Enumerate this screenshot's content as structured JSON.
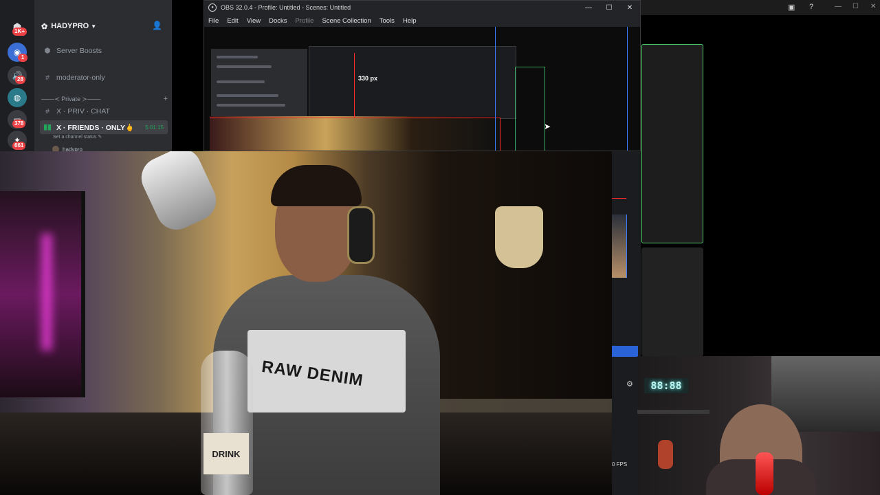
{
  "discord": {
    "server_name": "HADYPRO",
    "guild_badges": [
      "1K+",
      "1",
      "28",
      "378",
      "661"
    ],
    "channels": [
      {
        "icon": "rocket-icon",
        "label": "Server Boosts"
      },
      {
        "icon": "hash-icon",
        "label": "moderator-only"
      }
    ],
    "category": "───≺ Private ≻───",
    "private_channels": [
      {
        "icon": "hash-icon",
        "label": "X · PRIV · CHAT"
      },
      {
        "icon": "voice-icon",
        "label": "X · FRIENDS · ONLY🖕",
        "time": "5:01:15"
      }
    ],
    "channel_status": "Set a channel status ✎",
    "voice_user": "hadypro"
  },
  "obs": {
    "title": "OBS 32.0.4 - Profile: Untitled - Scenes: Untitled",
    "menu": [
      "File",
      "Edit",
      "View",
      "Docks",
      "Profile",
      "Scene Collection",
      "Tools",
      "Help"
    ],
    "preview_label": "330 px",
    "fps": "0 FPS"
  },
  "webcam": {
    "bottle_label": "DRINK",
    "shirt_text": "RAW DENIM",
    "clock_reading": "88:88"
  },
  "colors": {
    "discord_bg": "#2b2d31",
    "obs_bg": "#1b1c1f",
    "accent_green": "#4fd16c",
    "obs_blue": "#2a62d8",
    "selection_red": "#ff2a2a"
  }
}
